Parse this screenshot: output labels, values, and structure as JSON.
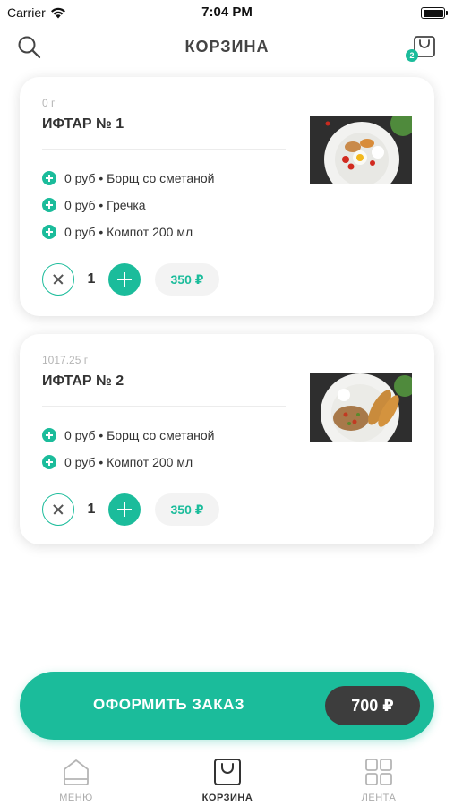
{
  "status_bar": {
    "carrier": "Carrier",
    "time": "7:04 PM"
  },
  "header": {
    "title": "КОРЗИНА",
    "cart_count": "2"
  },
  "cart_items": [
    {
      "weight": "0 г",
      "title": "ИФТАР № 1",
      "addons": [
        "0 руб • Борщ со сметаной",
        "0 руб • Гречка",
        "0 руб • Компот 200 мл"
      ],
      "quantity": "1",
      "price": "350 ₽"
    },
    {
      "weight": "1017.25 г",
      "title": "ИФТАР № 2",
      "addons": [
        "0 руб • Борщ со сметаной",
        "0 руб • Компот 200 мл"
      ],
      "quantity": "1",
      "price": "350 ₽"
    }
  ],
  "checkout": {
    "label": "ОФОРМИТЬ ЗАКАЗ",
    "total": "700 ₽"
  },
  "tabs": [
    {
      "label": "МЕНЮ",
      "icon": "home-icon",
      "active": false
    },
    {
      "label": "КОРЗИНА",
      "icon": "bag-icon",
      "active": true
    },
    {
      "label": "ЛЕНТА",
      "icon": "grid-icon",
      "active": false
    }
  ],
  "colors": {
    "accent": "#1bbc9b",
    "total_pill": "#3d3d3d",
    "text": "#333333",
    "muted": "#aaaaaa"
  }
}
